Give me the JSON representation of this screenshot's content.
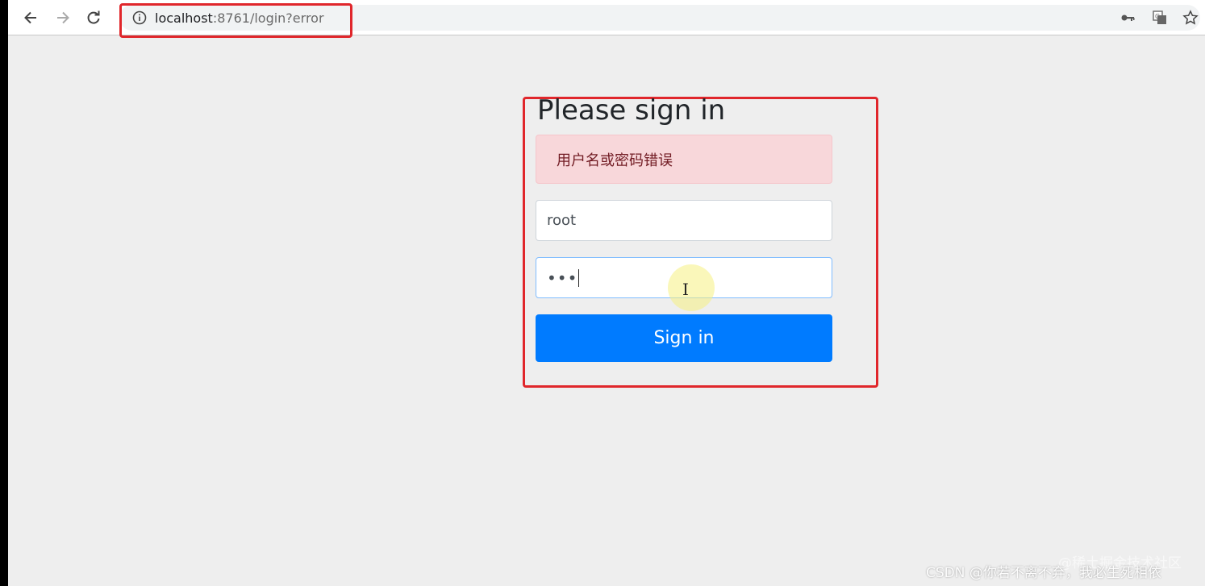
{
  "browser": {
    "url_host": "localhost",
    "url_path": ":8761/login?error",
    "icons": [
      "back-icon",
      "forward-icon",
      "reload-icon",
      "info-icon",
      "key-icon",
      "translate-icon",
      "star-icon"
    ]
  },
  "login": {
    "heading": "Please sign in",
    "error_message": "用户名或密码错误",
    "username_value": "root",
    "password_value": "•••",
    "signin_label": "Sign in"
  },
  "colors": {
    "primary": "#007bff",
    "alert_bg": "#f8d7da",
    "alert_text": "#721c24",
    "annotation_red": "#e0262b"
  },
  "watermark": {
    "text": "CSDN @你若不离不弃，我必生死相依",
    "overlay_text": "@稀土掘金技术社区"
  }
}
